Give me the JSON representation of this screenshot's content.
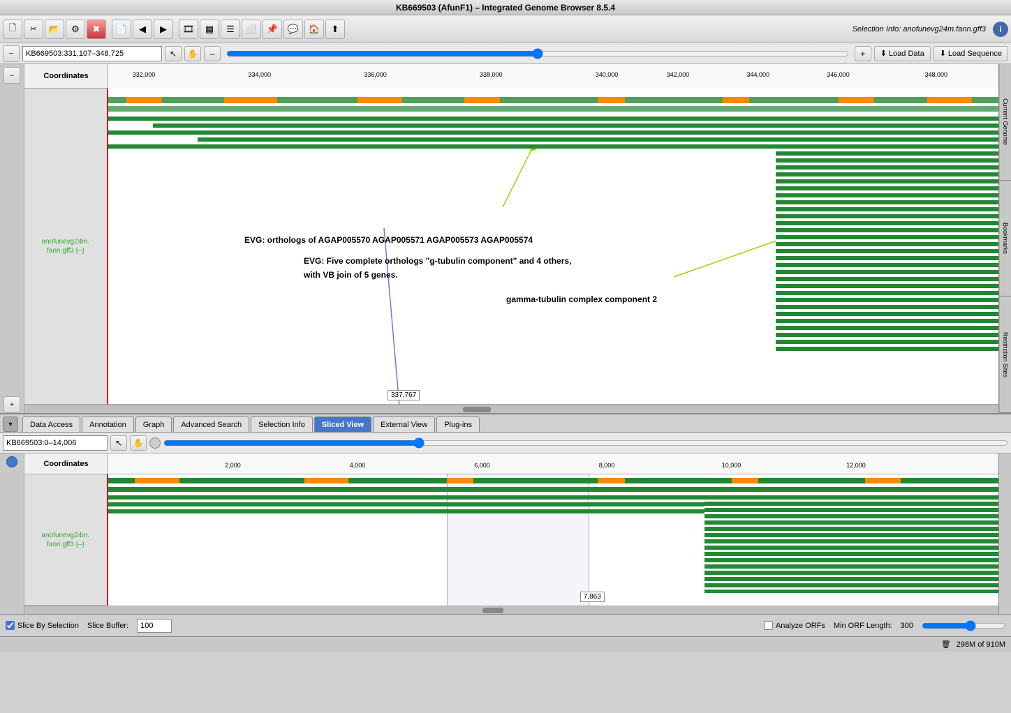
{
  "window": {
    "title": "KB669503  (AfunF1)  –  Integrated Genome Browser  8.5.4"
  },
  "toolbar": {
    "buttons": [
      "⬛",
      "✂",
      "📋",
      "⚙",
      "✖",
      "📄",
      "◀",
      "▶",
      "📽",
      "▦",
      "☰",
      "⬜",
      "📌",
      "💬",
      "🏠",
      "⬆"
    ],
    "selection_info_label": "Selection Info:  anofunevg24m.fann.gff3",
    "info_icon": "i"
  },
  "nav_bar": {
    "coord_value": "KB669503:331,107–348,725",
    "coord_placeholder": "KB669503:331,107–348,725",
    "load_data_label": "Load Data",
    "load_sequence_label": "Load Sequence"
  },
  "coordinates_track": {
    "label": "Coordinates",
    "ticks": [
      {
        "value": "332,000",
        "pct": 4
      },
      {
        "value": "334,000",
        "pct": 17
      },
      {
        "value": "336,000",
        "pct": 30
      },
      {
        "value": "338,000",
        "pct": 43
      },
      {
        "value": "340,000",
        "pct": 56
      },
      {
        "value": "342,000",
        "pct": 64
      },
      {
        "value": "344,000",
        "pct": 73
      },
      {
        "value": "346,000",
        "pct": 82
      },
      {
        "value": "348,000",
        "pct": 93
      }
    ]
  },
  "genome_track": {
    "label": "anofunevg24m.\nfann.gff3 (–)"
  },
  "annotations": {
    "label1": "EVG: orthologs of AGAP005570 AGAP005571 AGAP005573 AGAP005574",
    "label2": "EVG: Five complete orthologs \"g-tubulin component\" and 4 others,",
    "label3": "with VB join of 5 genes.",
    "label4": "gamma-tubulin complex component 2",
    "position_marker": "337,767"
  },
  "tabs": {
    "expand_icon": "▾",
    "items": [
      {
        "label": "Data Access",
        "active": false
      },
      {
        "label": "Annotation",
        "active": false
      },
      {
        "label": "Graph",
        "active": false
      },
      {
        "label": "Advanced Search",
        "active": false
      },
      {
        "label": "Selection Info",
        "active": false
      },
      {
        "label": "Sliced View",
        "active": true
      },
      {
        "label": "External View",
        "active": false
      },
      {
        "label": "Plug-ins",
        "active": false
      }
    ]
  },
  "sliced_view": {
    "coord_value": "KB669503:0–14,006",
    "ticks": [
      {
        "value": "2,000",
        "pct": 14
      },
      {
        "value": "4,000",
        "pct": 28
      },
      {
        "value": "6,000",
        "pct": 42
      },
      {
        "value": "8,000",
        "pct": 56
      },
      {
        "value": "10,000",
        "pct": 70
      },
      {
        "value": "12,000",
        "pct": 84
      }
    ],
    "track_label": "anofunevg24m.\nfann.gff3 (–)",
    "position_marker": "7,863"
  },
  "bottom_controls": {
    "slice_by_selection_label": "Slice By Selection",
    "slice_buffer_label": "Slice Buffer:",
    "slice_buffer_value": "100",
    "analyze_orfs_label": "Analyze ORFs",
    "min_orf_length_label": "Min ORF Length:",
    "min_orf_length_value": "300"
  },
  "status_bar": {
    "memory": "298M of 910M"
  },
  "right_sidebar": {
    "tabs": [
      "Current Genome",
      "Bookmarks",
      "Restriction Sites"
    ]
  }
}
